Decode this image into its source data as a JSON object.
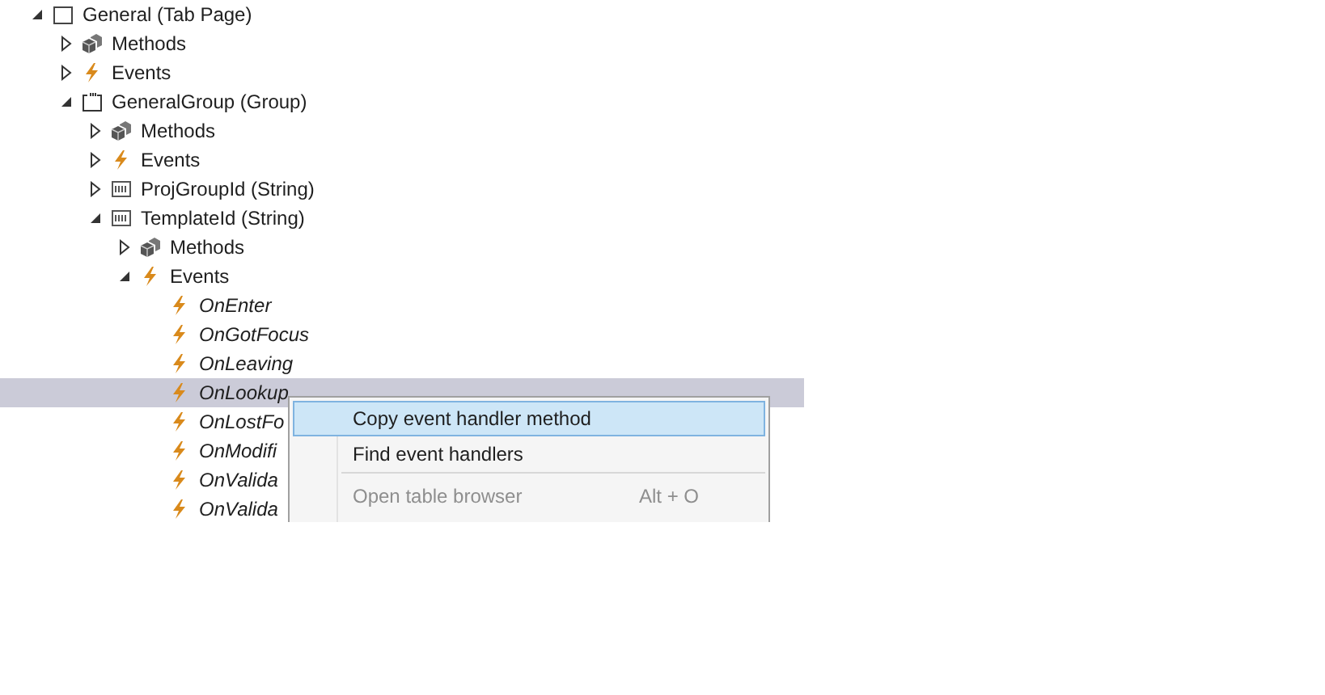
{
  "tree": [
    {
      "label": "General (Tab Page)",
      "kind": "tabpage",
      "expanded": true,
      "selected": false,
      "children": [
        {
          "label": "Methods",
          "kind": "methods",
          "expanded": false,
          "selected": false
        },
        {
          "label": "Events",
          "kind": "events",
          "expanded": false,
          "selected": false
        },
        {
          "label": "GeneralGroup (Group)",
          "kind": "group",
          "expanded": true,
          "selected": false,
          "children": [
            {
              "label": "Methods",
              "kind": "methods",
              "expanded": false,
              "selected": false
            },
            {
              "label": "Events",
              "kind": "events",
              "expanded": false,
              "selected": false
            },
            {
              "label": "ProjGroupId (String)",
              "kind": "string",
              "expanded": false,
              "selected": false
            },
            {
              "label": "TemplateId (String)",
              "kind": "string",
              "expanded": true,
              "selected": false,
              "children": [
                {
                  "label": "Methods",
                  "kind": "methods",
                  "expanded": false,
                  "selected": false
                },
                {
                  "label": "Events",
                  "kind": "events",
                  "expanded": true,
                  "selected": false,
                  "children": [
                    {
                      "label": "OnEnter",
                      "kind": "handler",
                      "selected": false
                    },
                    {
                      "label": "OnGotFocus",
                      "kind": "handler",
                      "selected": false
                    },
                    {
                      "label": "OnLeaving",
                      "kind": "handler",
                      "selected": false
                    },
                    {
                      "label": "OnLookup",
                      "kind": "handler",
                      "selected": true
                    },
                    {
                      "label": "OnLostFo",
                      "kind": "handler",
                      "selected": false
                    },
                    {
                      "label": "OnModifi",
                      "kind": "handler",
                      "selected": false
                    },
                    {
                      "label": "OnValida",
                      "kind": "handler",
                      "selected": false
                    },
                    {
                      "label": "OnValida",
                      "kind": "handler",
                      "selected": false
                    }
                  ]
                }
              ]
            }
          ]
        }
      ]
    }
  ],
  "context_menu": {
    "items": [
      {
        "kind": "item",
        "label": "Copy event handler method",
        "highlighted": true,
        "disabled": false
      },
      {
        "kind": "item",
        "label": "Find event handlers",
        "highlighted": false,
        "disabled": false
      },
      {
        "kind": "separator"
      },
      {
        "kind": "item",
        "label": "Open table browser",
        "shortcut": "Alt + O",
        "highlighted": false,
        "disabled": true
      }
    ]
  }
}
